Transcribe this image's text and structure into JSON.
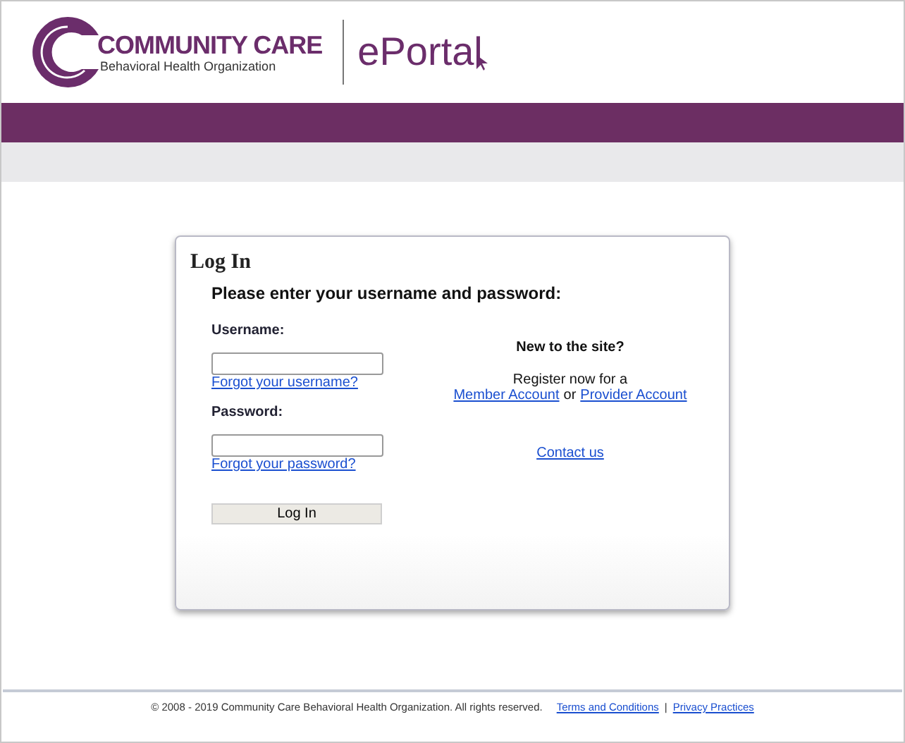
{
  "header": {
    "brand": "COMMUNITY CARE",
    "tagline": "Behavioral Health Organization",
    "portal": "ePortal"
  },
  "login": {
    "title": "Log In",
    "instruction": "Please enter your username and password:",
    "fields": [
      {
        "label": "Username:",
        "link": "Forgot your username?"
      },
      {
        "label": "Password:",
        "link": "Forgot your password?"
      }
    ],
    "button": "Log In"
  },
  "register": {
    "heading": "New to the site?",
    "text": "Register now for a",
    "link_1": "Member Account",
    "joiner": "or",
    "link_2": "Provider Account",
    "contact": "Contact us"
  },
  "footer": {
    "copyright": "© 2008 - 2019 Community Care Behavioral Health Organization. All rights reserved.",
    "link_1": "Terms and Conditions",
    "separator": "|",
    "link_2": "Privacy Practices"
  }
}
